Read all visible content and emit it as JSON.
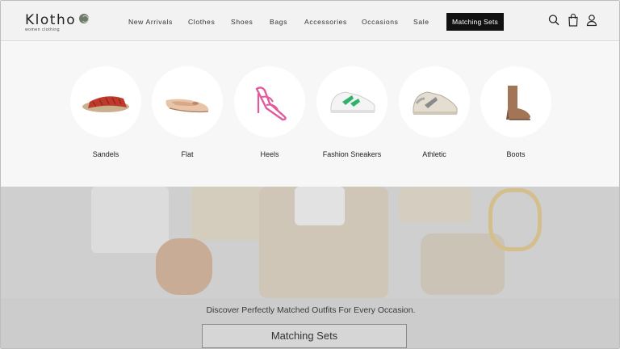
{
  "brand": {
    "name": "Klotho",
    "tagline": "women clothing"
  },
  "nav": {
    "items": [
      {
        "label": "New Arrivals"
      },
      {
        "label": "Clothes"
      },
      {
        "label": "Shoes"
      },
      {
        "label": "Bags"
      },
      {
        "label": "Accessories"
      },
      {
        "label": "Occasions"
      },
      {
        "label": "Sale"
      },
      {
        "label": "Matching Sets",
        "active": true
      }
    ],
    "icons": [
      "search-icon",
      "shopping-bag-icon",
      "user-icon"
    ]
  },
  "categories": [
    {
      "label": "Sandels",
      "icon": "sandal-icon"
    },
    {
      "label": "Flat",
      "icon": "flat-shoe-icon"
    },
    {
      "label": "Heels",
      "icon": "heel-icon"
    },
    {
      "label": "Fashion Sneakers",
      "icon": "fashion-sneaker-icon"
    },
    {
      "label": "Athletic",
      "icon": "athletic-shoe-icon"
    },
    {
      "label": "Boots",
      "icon": "boot-icon"
    }
  ],
  "hero": {
    "tagline": "Discover Perfectly Matched Outfits For Every Occasion.",
    "cta_label": "Matching Sets"
  },
  "colors": {
    "header_bg": "#f2f2f2",
    "active_nav_bg": "#111111",
    "panel_bg": "#f7f7f7",
    "hero_bg": "#cfcfcf"
  }
}
